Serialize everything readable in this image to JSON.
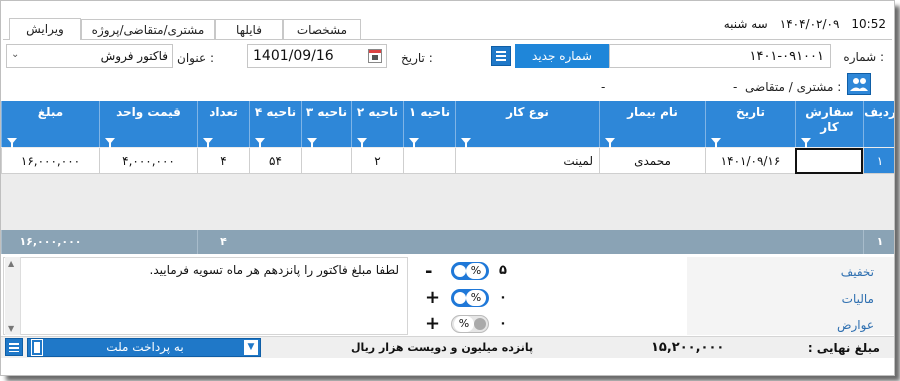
{
  "header": {
    "time": "10:52",
    "day": "سه شنبه",
    "date": "۱۴۰۴/۰۲/۰۹"
  },
  "tabs": [
    {
      "label": "ویرایش",
      "active": true
    },
    {
      "label": "مشتری/متقاضی/پروژه",
      "active": false
    },
    {
      "label": "فایلها",
      "active": false
    },
    {
      "label": "مشخصات",
      "active": false
    }
  ],
  "form": {
    "number_label": "شماره :",
    "number_value": "۱۴۰۱-۰۹۱۰۰۱",
    "new_number_button": "شماره جدید",
    "date_label": "تاریخ :",
    "date_value": "1401/09/16",
    "title_label": "عنوان :",
    "title_value": "فاکتور فروش",
    "customer_label": "مشتری / متقاضی :",
    "customer_value": "-",
    "customer_extra": "-"
  },
  "grid": {
    "columns": [
      "ردیف",
      "سفارش کار",
      "تاریخ",
      "نام بیمار",
      "نوع کار",
      "ناحیه ۱",
      "ناحیه ۲",
      "ناحیه ۳",
      "ناحیه ۴",
      "تعداد",
      "قیمت واحد",
      "مبلغ"
    ],
    "rows": [
      {
        "radif": "۱",
        "sefaresh": "",
        "tarikh": "۱۴۰۱/۰۹/۱۶",
        "bimar": "محمدی",
        "kar": "لمینت",
        "n1": "",
        "n2": "۲",
        "n3": "",
        "n4": "۵۴",
        "tedad": "۴",
        "gheymat": "۴,۰۰۰,۰۰۰",
        "mablagh": "۱۶,۰۰۰,۰۰۰"
      }
    ],
    "footer": {
      "radif": "۱",
      "tedad": "۴",
      "mablagh": "۱۶,۰۰۰,۰۰۰"
    }
  },
  "memo": {
    "text": "لطفا مبلغ فاکتور را پانزدهم هر ماه تسویه فرمایید."
  },
  "adjustments": [
    {
      "label": "تخفیف",
      "sign": "-",
      "value": "۵",
      "percent": true
    },
    {
      "label": "مالیات",
      "sign": "+",
      "value": "۰",
      "percent": true
    },
    {
      "label": "عوارض",
      "sign": "+",
      "value": "۰",
      "percent": false
    }
  ],
  "pct_symbol": "%",
  "status": {
    "final_label": "مبلغ نهایی :",
    "final_value": "۱۵,۲۰۰,۰۰۰",
    "words": "پانزده میلیون و دویست  هزار  ریال",
    "bank_value": "به پرداخت ملت"
  },
  "colors": {
    "accent": "#2e87d8",
    "footer": "#8aa3b5",
    "toggle_on": "#1f78d8"
  }
}
